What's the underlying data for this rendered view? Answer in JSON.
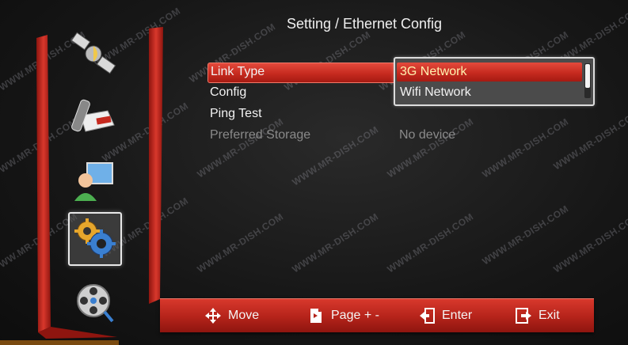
{
  "title": "Setting / Ethernet Config",
  "sidebar": {
    "items": [
      {
        "icon": "satellite-icon"
      },
      {
        "icon": "tv-remote-icon"
      },
      {
        "icon": "user-computer-icon"
      },
      {
        "icon": "gears-icon",
        "selected": true
      },
      {
        "icon": "film-reel-icon"
      }
    ]
  },
  "menu": {
    "items": [
      {
        "label": "Link Type",
        "value": ""
      },
      {
        "label": "Config",
        "value": ""
      },
      {
        "label": "Ping Test",
        "value": ""
      },
      {
        "label": "Preferred Storage",
        "value": "No device"
      }
    ]
  },
  "dropdown": {
    "options": [
      "3G Network",
      "Wifi Network"
    ],
    "selected_index": 0
  },
  "bottom_bar": {
    "hints": [
      {
        "icon": "move-arrows-icon",
        "label": "Move"
      },
      {
        "icon": "page-icon",
        "label": "Page + -"
      },
      {
        "icon": "enter-icon",
        "label": "Enter"
      },
      {
        "icon": "exit-icon",
        "label": "Exit"
      }
    ]
  },
  "watermark": "WWW.MR-DISH.COM",
  "colors": {
    "highlight": "#c62a1f",
    "bar": "#b4231a",
    "background": "#151515"
  }
}
